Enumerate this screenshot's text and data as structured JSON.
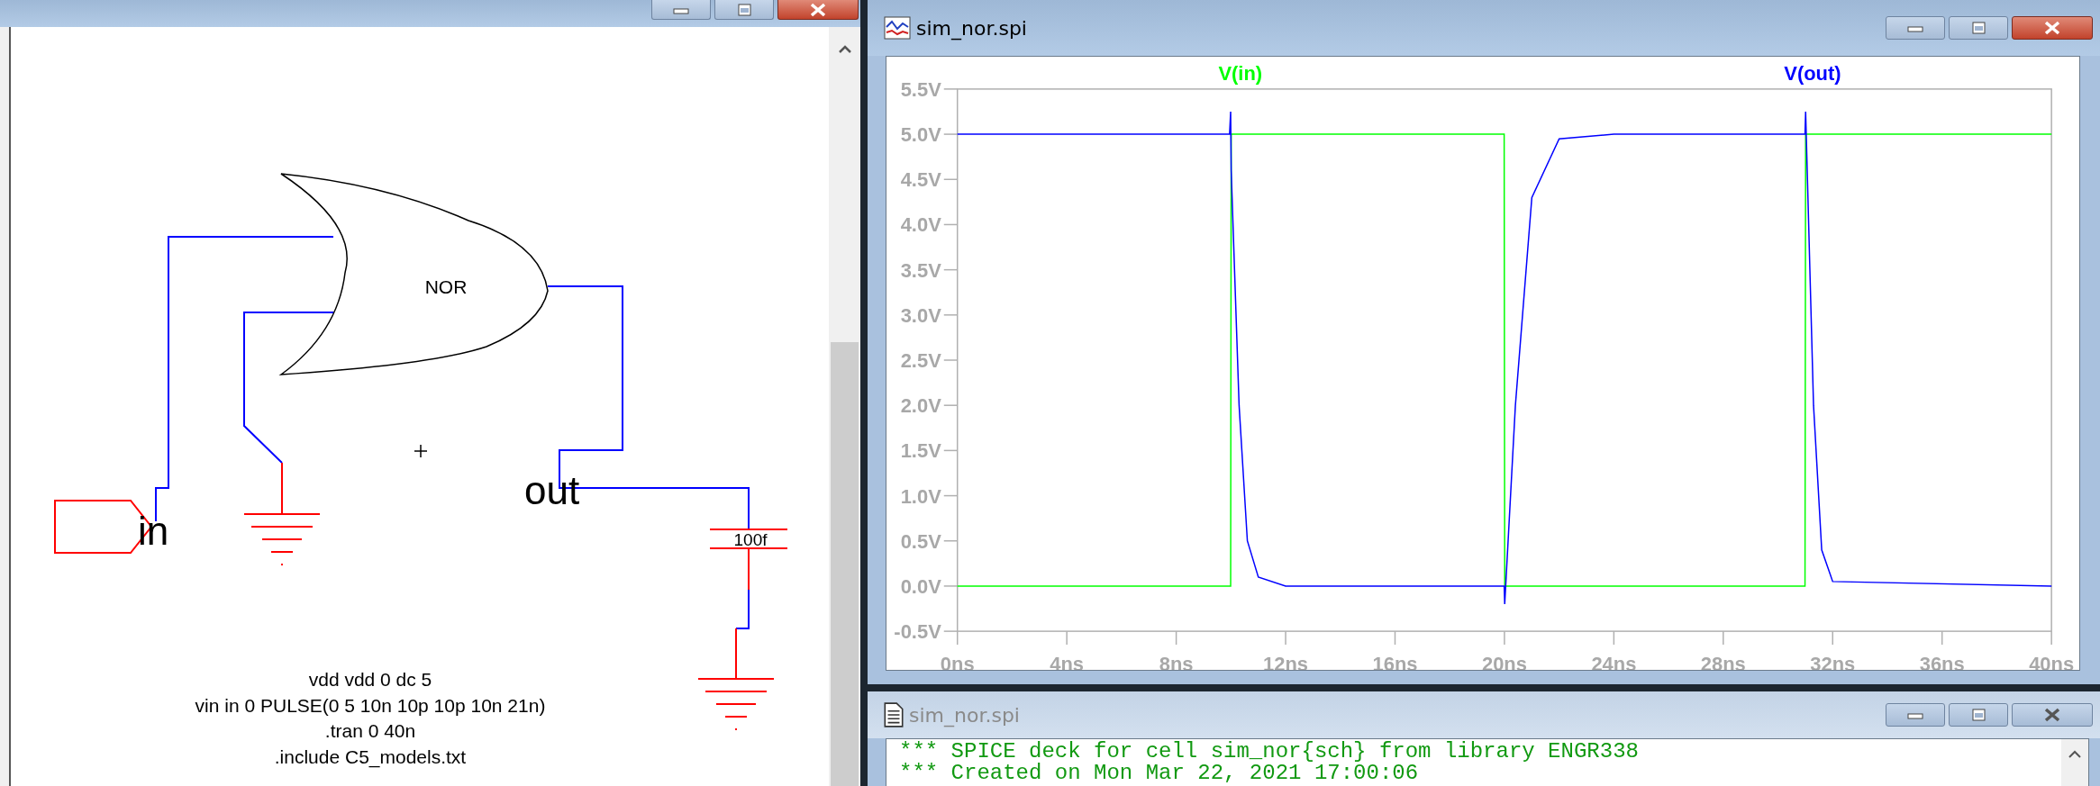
{
  "schematic_window": {
    "schematic": {
      "gate_label": "NOR",
      "input_label": "in",
      "output_label": "out",
      "capacitor_value": "100f",
      "spice_directives": [
        "vdd vdd 0 dc 5",
        "vin in 0 PULSE(0 5 10n 10p 10p 10n 21n)",
        ".tran 0 40n",
        ".include C5_models.txt"
      ]
    }
  },
  "plot_window": {
    "title": "sim_nor.spi",
    "active": true,
    "chart_data": {
      "type": "line",
      "x": [
        0,
        9.95,
        9.99,
        10.01,
        10.3,
        10.6,
        11,
        12,
        19.99,
        20.01,
        20.4,
        21,
        22,
        24,
        30.99,
        31.01,
        31.3,
        31.6,
        32,
        40
      ],
      "xlim": [
        0,
        40
      ],
      "ylim": [
        -0.5,
        5.5
      ],
      "xticks": [
        {
          "value": 0,
          "label": "0ns"
        },
        {
          "value": 4,
          "label": "4ns"
        },
        {
          "value": 8,
          "label": "8ns"
        },
        {
          "value": 12,
          "label": "12ns"
        },
        {
          "value": 16,
          "label": "16ns"
        },
        {
          "value": 20,
          "label": "20ns"
        },
        {
          "value": 24,
          "label": "24ns"
        },
        {
          "value": 28,
          "label": "28ns"
        },
        {
          "value": 32,
          "label": "32ns"
        },
        {
          "value": 36,
          "label": "36ns"
        },
        {
          "value": 40,
          "label": "40ns"
        }
      ],
      "yticks": [
        {
          "value": 5.5,
          "label": "5.5V"
        },
        {
          "value": 5,
          "label": "5.0V"
        },
        {
          "value": 4.5,
          "label": "4.5V"
        },
        {
          "value": 4,
          "label": "4.0V"
        },
        {
          "value": 3.5,
          "label": "3.5V"
        },
        {
          "value": 3,
          "label": "3.0V"
        },
        {
          "value": 2.5,
          "label": "2.5V"
        },
        {
          "value": 2,
          "label": "2.0V"
        },
        {
          "value": 1.5,
          "label": "1.5V"
        },
        {
          "value": 1,
          "label": "1.0V"
        },
        {
          "value": 0.5,
          "label": "0.5V"
        },
        {
          "value": 0,
          "label": "0.0V"
        },
        {
          "value": -0.5,
          "label": "-0.5V"
        }
      ],
      "series": [
        {
          "name": "V(in)",
          "color": "#00ff00",
          "values": [
            0,
            0,
            0,
            5,
            5,
            5,
            5,
            5,
            5,
            0,
            0,
            0,
            0,
            0,
            0,
            5,
            5,
            5,
            5,
            5
          ]
        },
        {
          "name": "V(out)",
          "color": "#0000ff",
          "values": [
            5,
            5,
            5.25,
            4.6,
            2,
            0.5,
            0.1,
            0,
            0,
            -0.2,
            2,
            4.3,
            4.95,
            5,
            5,
            5.25,
            2,
            0.4,
            0.05,
            0
          ]
        }
      ]
    }
  },
  "text_window": {
    "title": "sim_nor.spi",
    "active": false,
    "lines": [
      "*** SPICE deck for cell sim_nor{sch} from library ENGR338",
      "*** Created on Mon Mar 22, 2021 17:00:06"
    ]
  }
}
